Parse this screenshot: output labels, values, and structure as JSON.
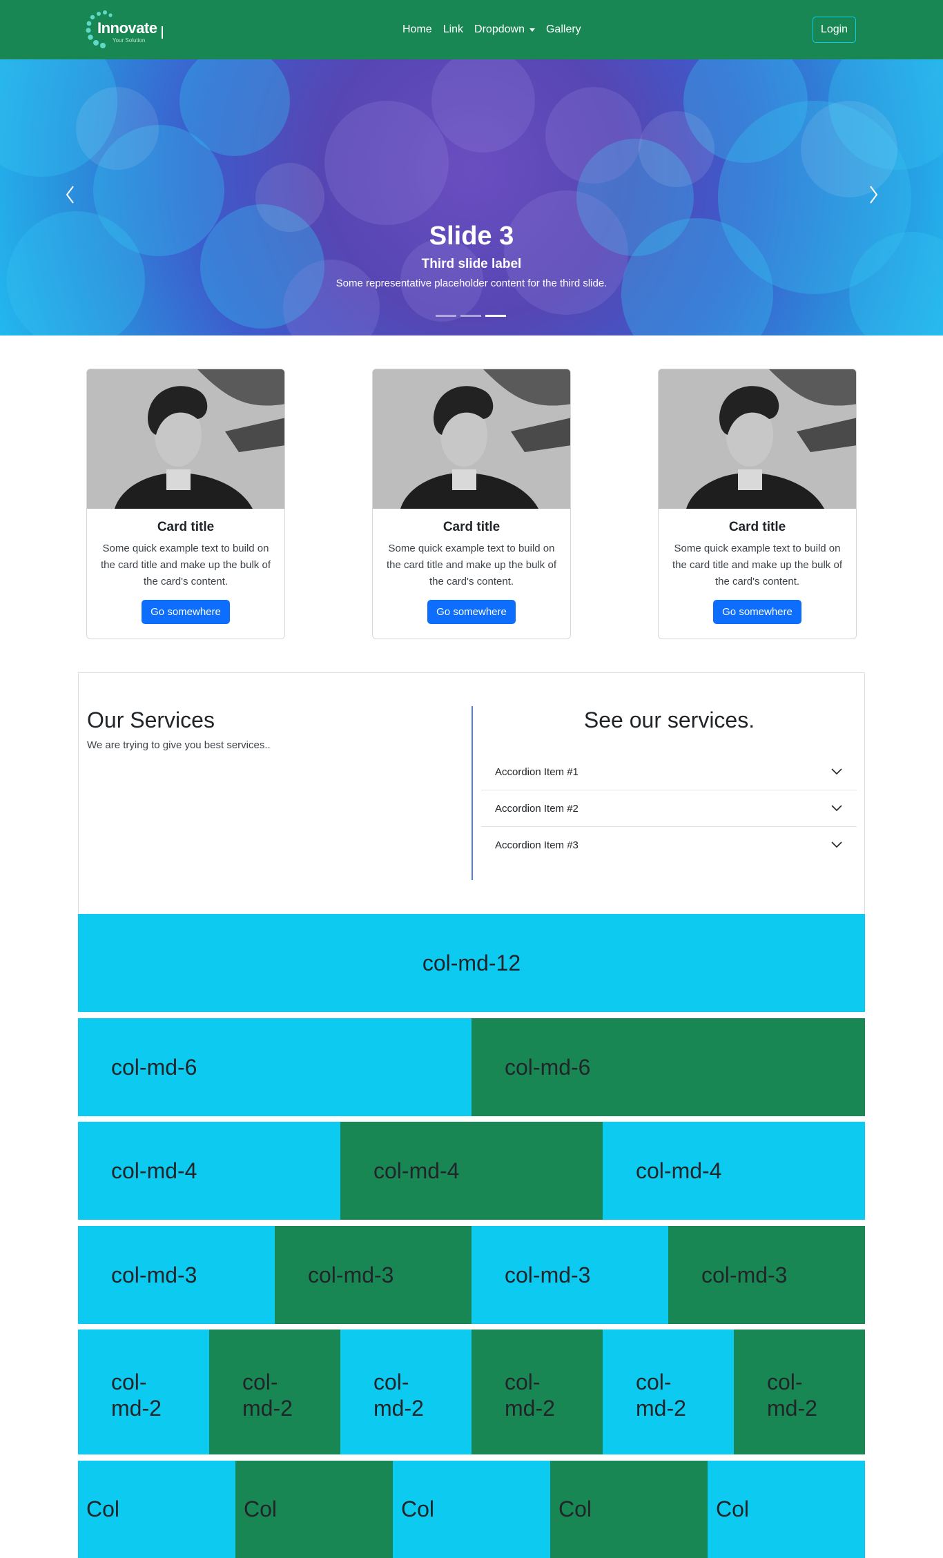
{
  "nav": {
    "brand": "Innovate",
    "tagline": "Your Solution",
    "links": [
      "Home",
      "Link",
      "Dropdown",
      "Gallery"
    ],
    "login": "Login",
    "color": "#198754"
  },
  "carousel": {
    "title": "Slide 3",
    "label": "Third slide label",
    "desc": "Some representative placeholder content for the third slide.",
    "indicator_count": 3,
    "active_indicator": 3
  },
  "cards": [
    {
      "title": "Card title",
      "text": "Some quick example text to build on the card title and make up the bulk of the card's content.",
      "button": "Go somewhere"
    },
    {
      "title": "Card title",
      "text": "Some quick example text to build on the card title and make up the bulk of the card's content.",
      "button": "Go somewhere"
    },
    {
      "title": "Card title",
      "text": "Some quick example text to build on the card title and make up the bulk of the card's content.",
      "button": "Go somewhere"
    }
  ],
  "services": {
    "title": "Our Services",
    "subtitle": "We are trying to give you best services..",
    "accordion_title": "See our services.",
    "accordion": [
      "Accordion Item #1",
      "Accordion Item #2",
      "Accordion Item #3"
    ]
  },
  "grid": {
    "row12": [
      "col-md-12"
    ],
    "row6": [
      "col-md-6",
      "col-md-6"
    ],
    "row4": [
      "col-md-4",
      "col-md-4",
      "col-md-4"
    ],
    "row3": [
      "col-md-3",
      "col-md-3",
      "col-md-3",
      "col-md-3"
    ],
    "row2": [
      "col-\nmd-2",
      "col-\nmd-2",
      "col-\nmd-2",
      "col-\nmd-2",
      "col-\nmd-2",
      "col-\nmd-2"
    ],
    "rowcol": [
      "Col",
      "Col",
      "Col",
      "Col",
      "Col"
    ]
  },
  "colors": {
    "cyan": "#0dcaf0",
    "green": "#198754",
    "primary": "#0d6efd"
  }
}
